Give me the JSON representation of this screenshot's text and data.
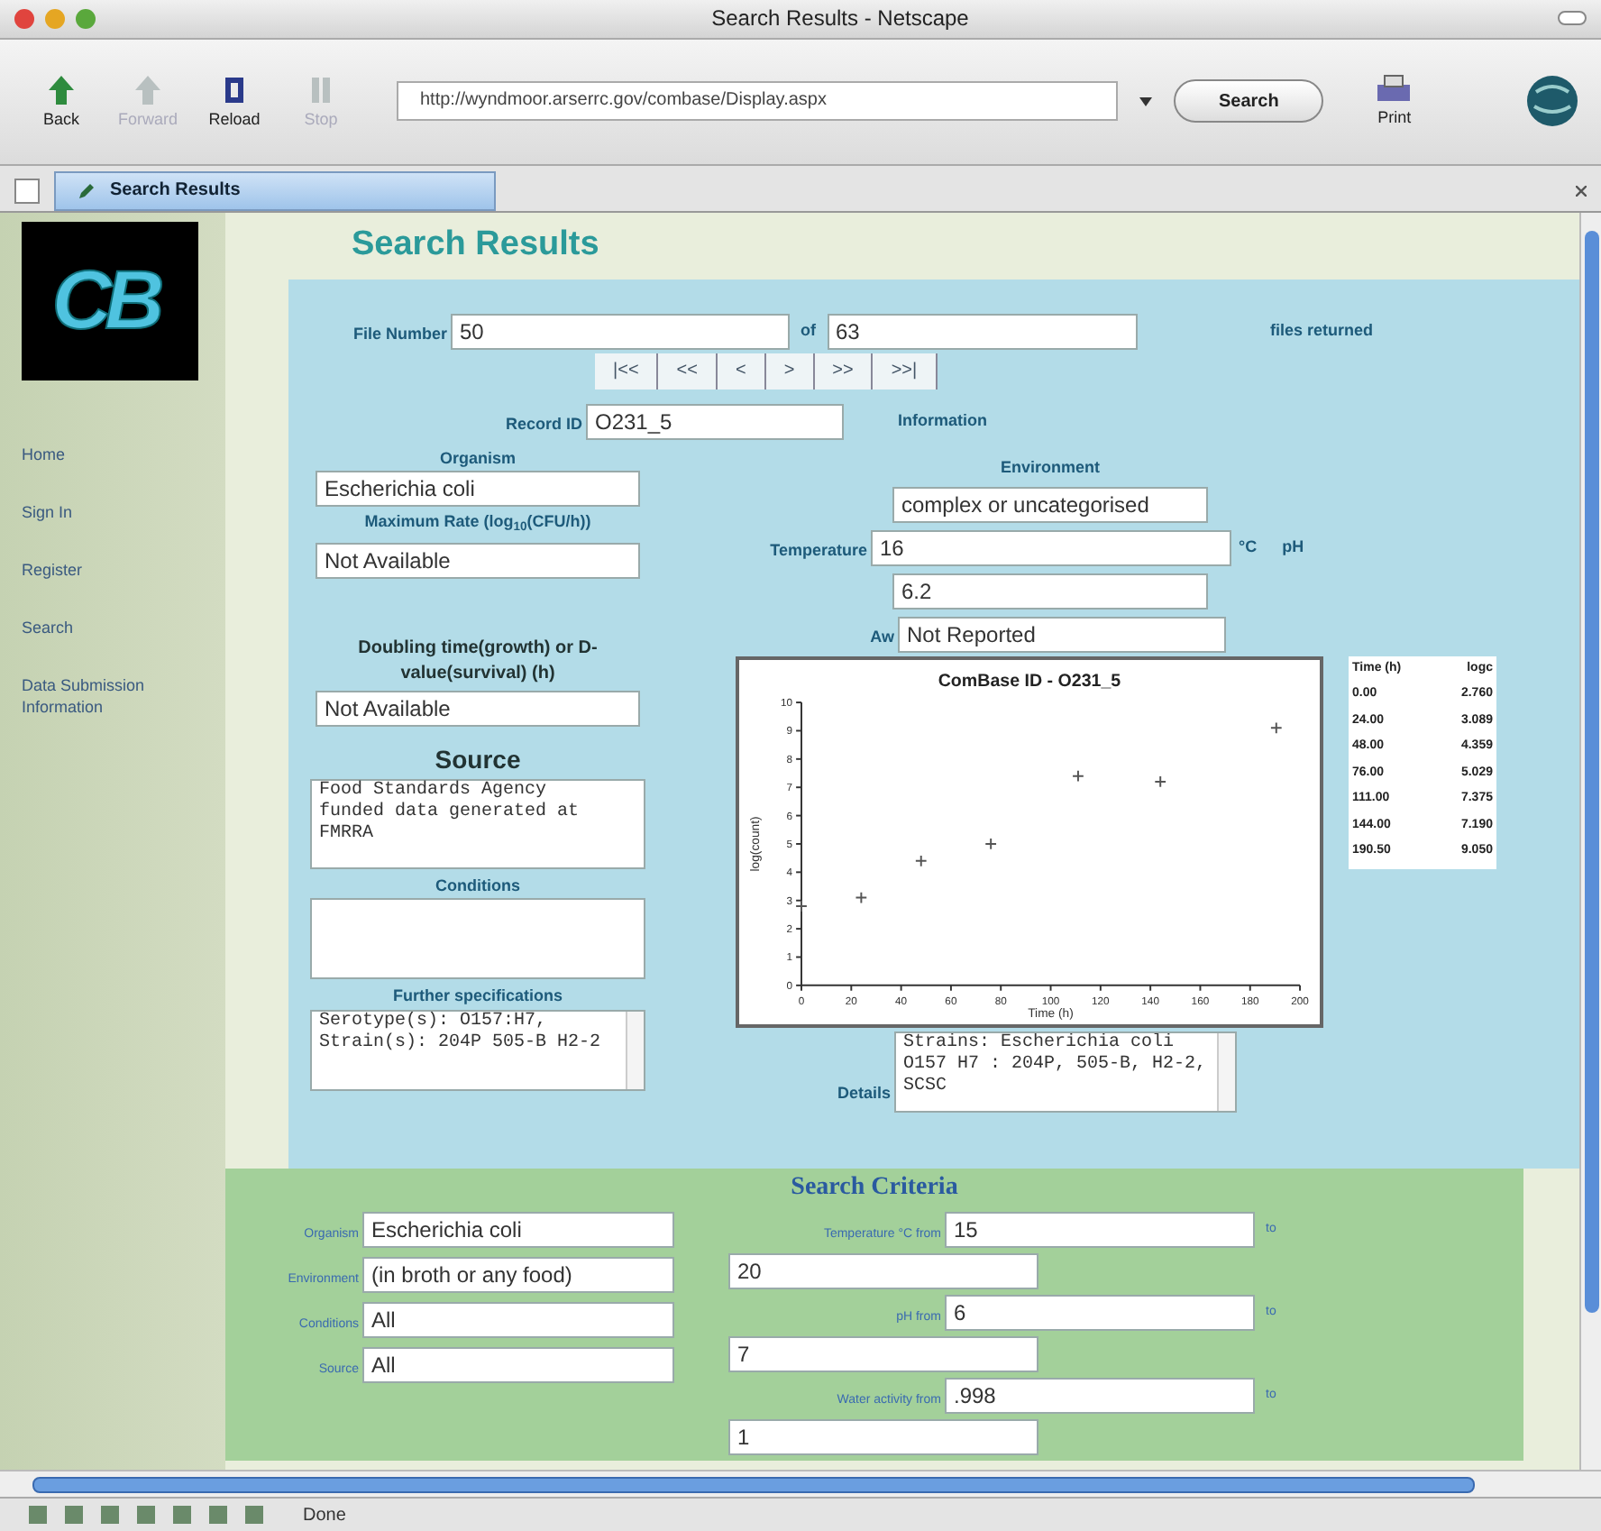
{
  "window": {
    "title": "Search Results - Netscape"
  },
  "toolbar": {
    "buttons": [
      {
        "kind": "back",
        "label": "Back",
        "disabled": false
      },
      {
        "kind": "forward",
        "label": "Forward",
        "disabled": true
      },
      {
        "kind": "reload",
        "label": "Reload",
        "disabled": false
      },
      {
        "kind": "stop",
        "label": "Stop",
        "disabled": true
      }
    ],
    "address": "http://wyndmoor.arserrc.gov/combase/Display.aspx",
    "search_button": "Search",
    "print_button": "Print"
  },
  "tabs": [
    {
      "label": "Search Results",
      "selected": true
    }
  ],
  "sidebar": {
    "logo_text": "CB",
    "items": [
      {
        "label": "Home"
      },
      {
        "label": "Sign In"
      },
      {
        "label": "Register"
      },
      {
        "label": "Search"
      },
      {
        "label": "Data Submission Information"
      }
    ]
  },
  "page": {
    "title": "Search Results",
    "file_number": {
      "label": "File Number",
      "value": "50",
      "of_label": "of",
      "total": "63",
      "suffix": "files returned"
    },
    "pager": [
      "|<<",
      "<<",
      "<",
      ">",
      ">>",
      ">>|"
    ],
    "record_id": {
      "label": "Record ID",
      "value": "O231_5"
    },
    "information_label": "Information",
    "organism": {
      "label": "Organism",
      "value": "Escherichia coli"
    },
    "max_rate": {
      "label": "Maximum Rate (log$_{10}$(CFU/h))",
      "value": "Not Available"
    },
    "doubling": {
      "label": "Doubling time(growth) or D-value(survival) (h)",
      "value": "Not Available"
    },
    "source": {
      "heading": "Source",
      "value": "Food Standards Agency funded data generated at FMRRA"
    },
    "conditions": {
      "label": "Conditions"
    },
    "further_specifications": {
      "label": "Further specifications",
      "value": "Serotype(s): O157:H7, Strain(s): 204P 505-B H2-2"
    },
    "environment": {
      "label": "Environment",
      "value": "complex or uncategorised"
    },
    "temperature": {
      "label": "Temperature",
      "value": "16",
      "unit": "°C"
    },
    "ph": {
      "label": "pH",
      "value": "6.2"
    },
    "aw": {
      "label": "Aw",
      "value": "Not Reported"
    },
    "chart_data": {
      "type": "scatter",
      "title": "ComBase ID - O231_5",
      "xlabel": "Time (h)",
      "ylabel": "log(count)",
      "x": [
        0,
        24,
        48,
        76,
        111,
        144,
        190.5
      ],
      "series": [
        {
          "color": "#555555",
          "values": [
            2.8,
            3.1,
            4.4,
            5.0,
            7.4,
            7.2,
            9.1
          ]
        }
      ],
      "xlim": [
        0,
        200
      ],
      "ylim": [
        0,
        10
      ],
      "xticks": [
        0,
        20,
        40,
        60,
        80,
        100,
        120,
        140,
        160,
        180,
        200
      ],
      "yticks": [
        0,
        1,
        2,
        3,
        4,
        5,
        6,
        7,
        8,
        9,
        10
      ]
    },
    "data_table": {
      "headers": [
        "Time (h)",
        "logc"
      ],
      "rows": [
        [
          "0.00",
          "2.760"
        ],
        [
          "24.00",
          "3.089"
        ],
        [
          "48.00",
          "4.359"
        ],
        [
          "76.00",
          "5.029"
        ],
        [
          "111.00",
          "7.375"
        ],
        [
          "144.00",
          "7.190"
        ],
        [
          "190.50",
          "9.050"
        ]
      ]
    },
    "details": {
      "label": "Details",
      "value": "Strains: Escherichia coli O157 H7 : 204P, 505-B, H2-2, SCSC"
    }
  },
  "search_criteria": {
    "title": "Search Criteria",
    "left": [
      {
        "label": "Organism",
        "value": "Escherichia coli"
      },
      {
        "label": "Environment",
        "value": "(in broth or any food)"
      },
      {
        "label": "Conditions",
        "value": "All"
      },
      {
        "label": "Source",
        "value": "All"
      }
    ],
    "right": [
      {
        "label": "Temperature °C from",
        "from": "15",
        "to_label": "to",
        "to": "20"
      },
      {
        "label": "pH from",
        "from": "6",
        "to_label": "to",
        "to": "7"
      },
      {
        "label": "Water activity from",
        "from": ".998",
        "to_label": "to",
        "to": "1"
      }
    ]
  },
  "status_bar": {
    "text": "Done"
  }
}
